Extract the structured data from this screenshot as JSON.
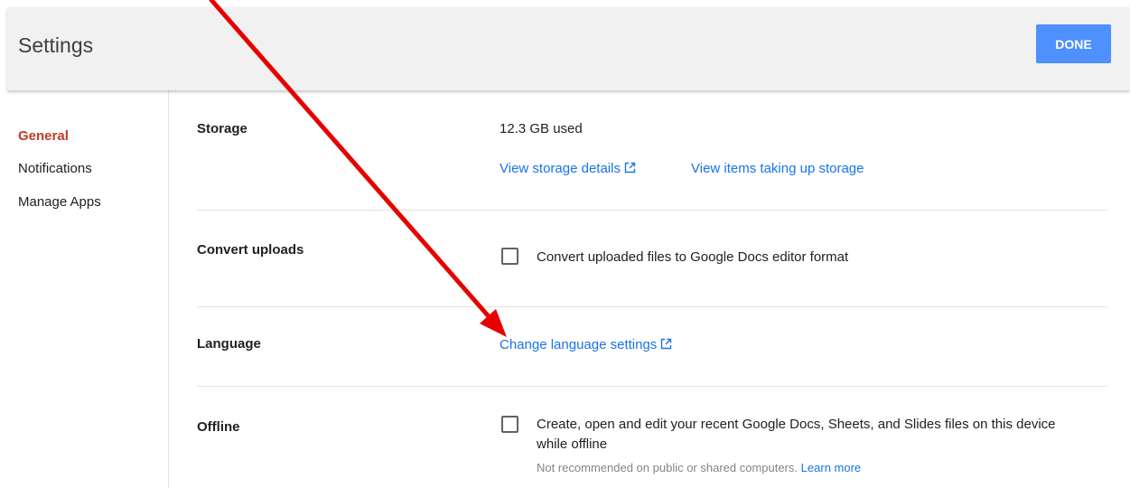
{
  "header": {
    "title": "Settings",
    "done_label": "DONE"
  },
  "sidebar": {
    "items": [
      {
        "label": "General",
        "active": true
      },
      {
        "label": "Notifications",
        "active": false
      },
      {
        "label": "Manage Apps",
        "active": false
      }
    ]
  },
  "storage": {
    "label": "Storage",
    "used": "12.3 GB used",
    "details_link": "View storage details",
    "items_link": "View items taking up storage"
  },
  "convert": {
    "label": "Convert uploads",
    "checkbox_label": "Convert uploaded files to Google Docs editor format",
    "checked": false
  },
  "language": {
    "label": "Language",
    "link": "Change language settings"
  },
  "offline": {
    "label": "Offline",
    "checkbox_label": "Create, open and edit your recent Google Docs, Sheets, and Slides files on this device while offline",
    "checked": false,
    "note": "Not recommended on public or shared computers.",
    "learn_more": "Learn more"
  },
  "colors": {
    "accent_blue": "#4d90fe",
    "link_blue": "#1a73e8",
    "active_nav": "#c0392b",
    "annotation_red": "#e60000"
  },
  "icons": {
    "external_link": "external-link-icon"
  }
}
